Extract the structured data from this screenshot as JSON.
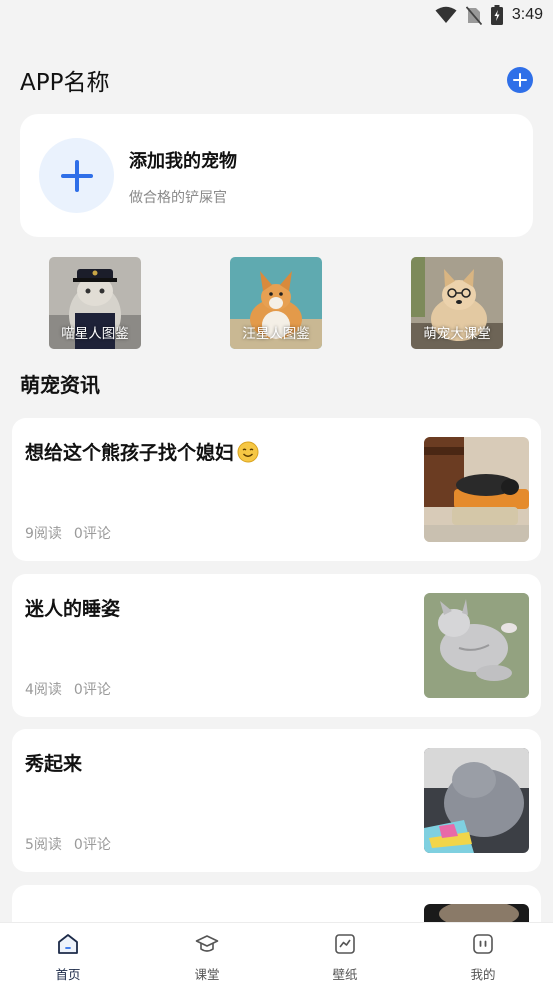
{
  "status_bar": {
    "time": "3:49",
    "icons": [
      "wifi-icon",
      "no-sim-icon",
      "battery-charging-icon"
    ]
  },
  "header": {
    "title": "APP名称",
    "add_icon": "plus-circle-icon"
  },
  "add_pet_card": {
    "title": "添加我的宠物",
    "subtitle": "做合格的铲屎官",
    "icon": "plus-icon"
  },
  "categories": [
    {
      "label": "喵星人图鉴"
    },
    {
      "label": "汪星人图鉴"
    },
    {
      "label": "萌宠大课堂"
    }
  ],
  "news_section": {
    "title": "萌宠资讯",
    "items": [
      {
        "title": "想给这个熊孩子找个媳妇",
        "emoji": "smiling-face-icon",
        "reads": "9阅读",
        "comments": "0评论"
      },
      {
        "title": "迷人的睡姿",
        "reads": "4阅读",
        "comments": "0评论"
      },
      {
        "title": "秀起来",
        "reads": "5阅读",
        "comments": "0评论"
      }
    ]
  },
  "tabbar": {
    "tabs": [
      {
        "label": "首页",
        "icon": "home-icon",
        "active": true
      },
      {
        "label": "课堂",
        "icon": "graduation-cap-icon",
        "active": false
      },
      {
        "label": "壁纸",
        "icon": "chart-image-icon",
        "active": false
      },
      {
        "label": "我的",
        "icon": "profile-face-icon",
        "active": false
      }
    ]
  },
  "colors": {
    "accent": "#2f6fe8",
    "background": "#f3f3f3",
    "card": "#ffffff",
    "muted_text": "#9a9a9a",
    "active_tab": "#1c2a48"
  }
}
